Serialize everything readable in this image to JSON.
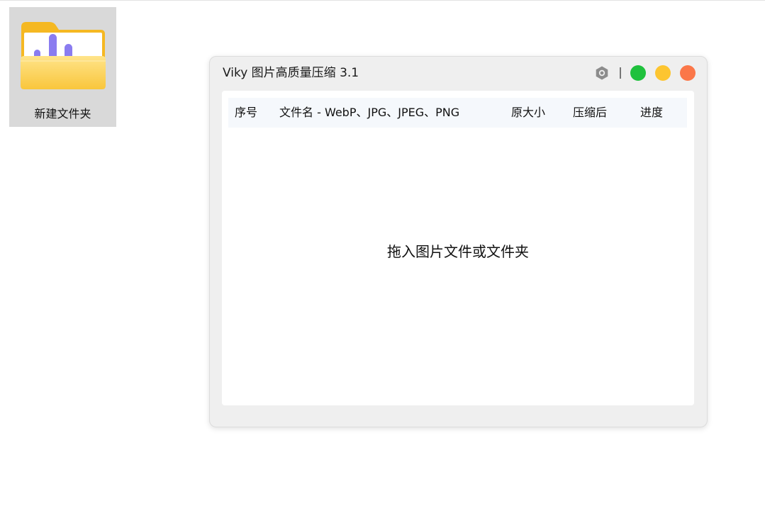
{
  "desktop": {
    "folder": {
      "label": "新建文件夹",
      "icon": "folder-icon"
    }
  },
  "app": {
    "title": "Viky 图片高质量压缩 3.1",
    "controls": {
      "settings_icon": "settings-icon",
      "green_color": "#1fc13d",
      "yellow_color": "#fdc530",
      "red_color": "#fb7749"
    },
    "table": {
      "columns": [
        "序号",
        "文件名 - WebP、JPG、JPEG、PNG",
        "原大小",
        "压缩后",
        "进度"
      ]
    },
    "drop_hint": "拖入图片文件或文件夹"
  }
}
